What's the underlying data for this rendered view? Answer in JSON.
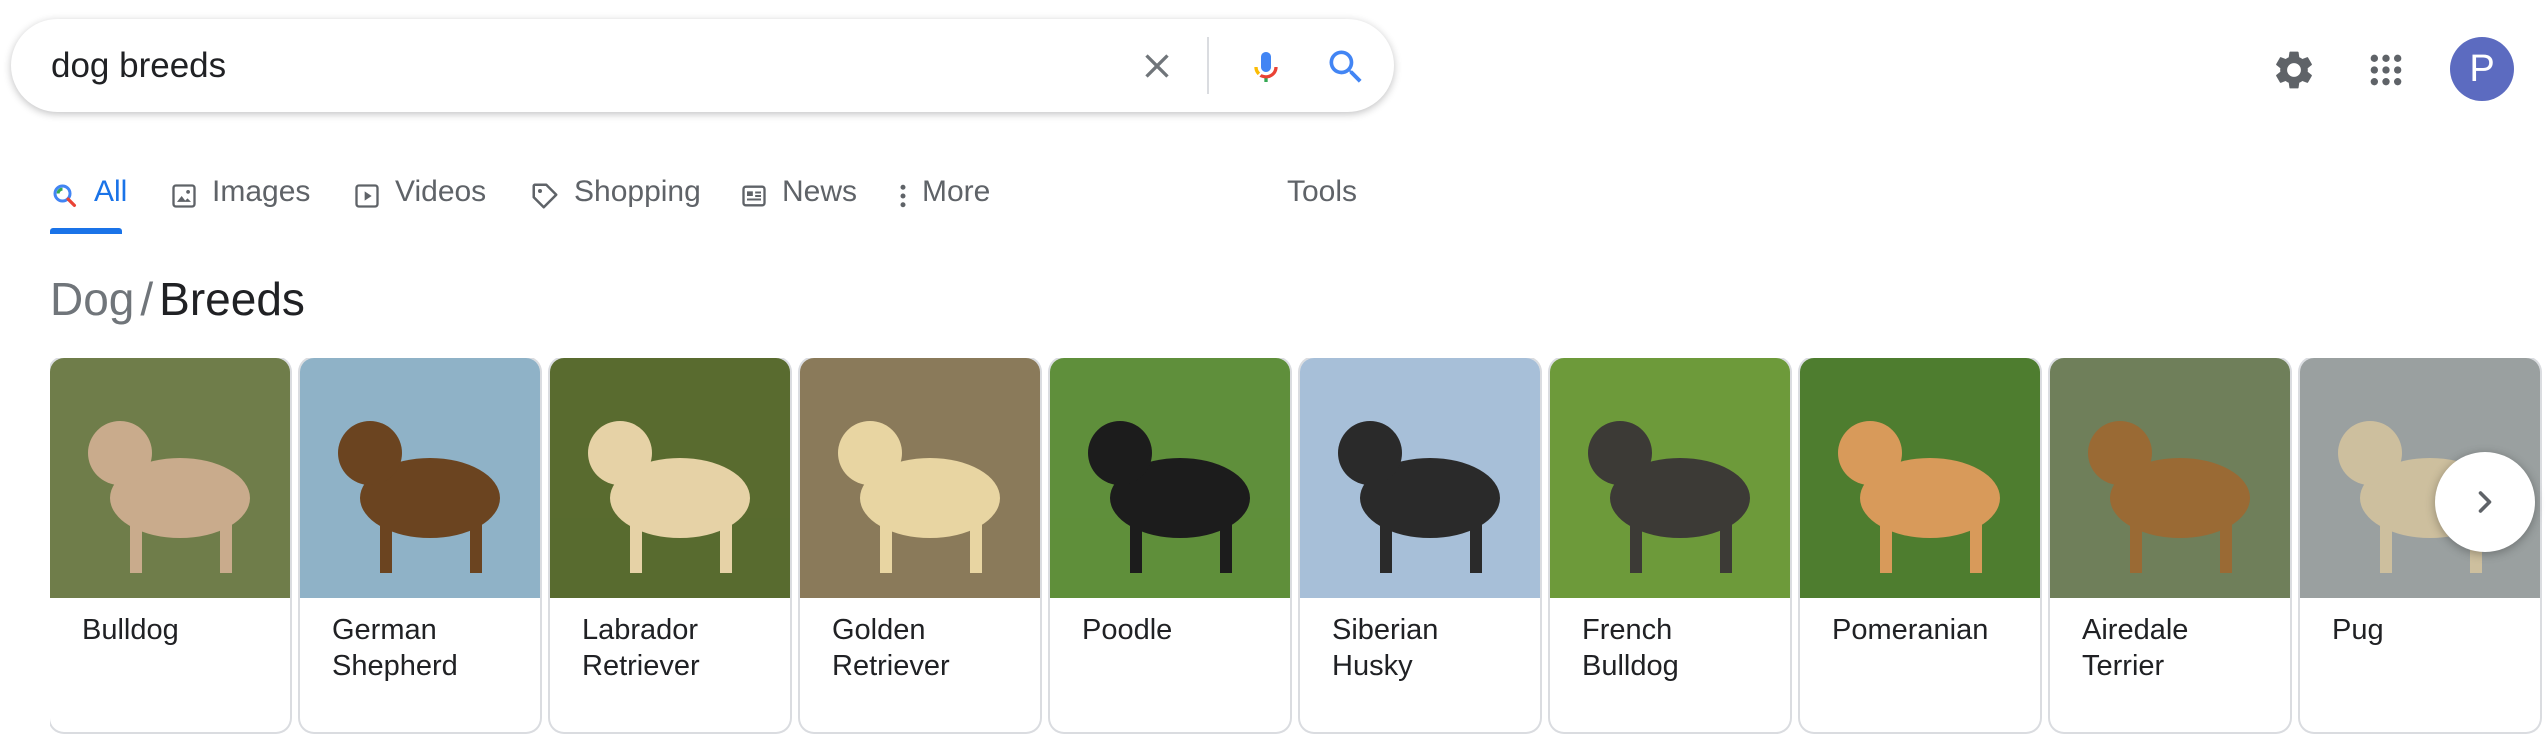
{
  "search": {
    "query": "dog breeds",
    "placeholder": ""
  },
  "header": {
    "avatar_letter": "P"
  },
  "tabs": [
    {
      "label": "All",
      "icon": "search-icon",
      "active": true
    },
    {
      "label": "Images",
      "icon": "image-icon"
    },
    {
      "label": "Videos",
      "icon": "play-icon"
    },
    {
      "label": "Shopping",
      "icon": "tag-icon"
    },
    {
      "label": "News",
      "icon": "newspaper-icon"
    },
    {
      "label": "More",
      "icon": "more-vert-icon"
    }
  ],
  "tools_label": "Tools",
  "breadcrumb": {
    "parent": "Dog",
    "separator": "/",
    "current": "Breeds"
  },
  "breeds": [
    {
      "name": "Bulldog",
      "colors": {
        "bg": "#6f7d4a",
        "dog": "#c9ab8c"
      }
    },
    {
      "name": "German\nShepherd",
      "colors": {
        "bg": "#8fb2c7",
        "dog": "#6b4420"
      }
    },
    {
      "name": "Labrador\nRetriever",
      "colors": {
        "bg": "#596b2f",
        "dog": "#e6d2a6"
      }
    },
    {
      "name": "Golden\nRetriever",
      "colors": {
        "bg": "#8a7a5a",
        "dog": "#e8d5a2"
      }
    },
    {
      "name": "Poodle",
      "colors": {
        "bg": "#5f8f3b",
        "dog": "#1c1c1c"
      }
    },
    {
      "name": "Siberian\nHusky",
      "colors": {
        "bg": "#a7bfd8",
        "dog": "#2a2a2a"
      }
    },
    {
      "name": "French\nBulldog",
      "colors": {
        "bg": "#6d9a3a",
        "dog": "#3c3a36"
      }
    },
    {
      "name": "Pomeranian",
      "colors": {
        "bg": "#4e7d2f",
        "dog": "#d89a5a"
      }
    },
    {
      "name": "Airedale\nTerrier",
      "colors": {
        "bg": "#6f7f5a",
        "dog": "#9a6a34"
      }
    },
    {
      "name": "Pug",
      "colors": {
        "bg": "#9aa0a0",
        "dog": "#cdbf9e"
      }
    }
  ],
  "colors": {
    "accent_blue": "#1a73e8",
    "text_secondary": "#5f6368",
    "avatar": "#5c6bc0"
  }
}
